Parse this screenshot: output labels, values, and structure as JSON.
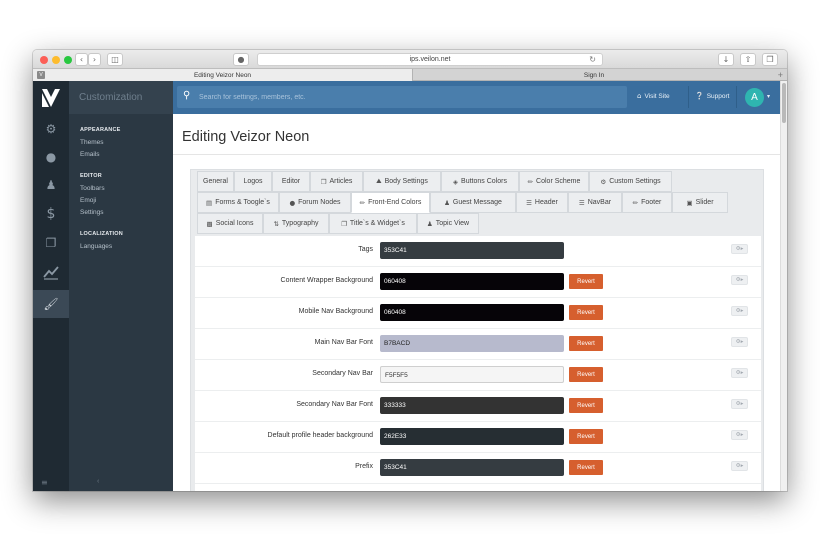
{
  "browser": {
    "url": "ips.veilon.net",
    "tabs": [
      {
        "title": "Editing Veizor Neon",
        "favicon": "V"
      },
      {
        "title": "Sign In"
      }
    ]
  },
  "rail": {
    "icons": [
      "logo-icon",
      "gears-icon",
      "chat-icon",
      "user-icon",
      "dollar-icon",
      "copy-icon",
      "chart-icon",
      "brush-icon"
    ],
    "active": "brush-icon",
    "bottom_icon": "menu-icon"
  },
  "subnav": {
    "title": "Customization",
    "groups": [
      {
        "label": "APPEARANCE",
        "items": [
          "Themes",
          "Emails"
        ]
      },
      {
        "label": "EDITOR",
        "items": [
          "Toolbars",
          "Emoji",
          "Settings"
        ]
      },
      {
        "label": "LOCALIZATION",
        "items": [
          "Languages"
        ]
      }
    ],
    "collapse_icon": "chevron-left-icon"
  },
  "topbar": {
    "search_placeholder": "Search for settings, members, etc.",
    "visit_site": "Visit Site",
    "support": "Support",
    "avatar_letter": "A"
  },
  "page": {
    "title": "Editing Veizor Neon"
  },
  "tabs": [
    {
      "label": "General",
      "icon": ""
    },
    {
      "label": "Logos",
      "icon": ""
    },
    {
      "label": "Editor",
      "icon": ""
    },
    {
      "label": "Articles",
      "icon": "articles-icon"
    },
    {
      "label": "Body Settings",
      "icon": "car-icon"
    },
    {
      "label": "Buttons Colors",
      "icon": "cube-icon"
    },
    {
      "label": "Color Scheme",
      "icon": "brush-icon"
    },
    {
      "label": "Custom Settings",
      "icon": "gear-icon"
    },
    {
      "label": "Forms & Toogle`s",
      "icon": "form-icon"
    },
    {
      "label": "Forum Nodes",
      "icon": "comments-icon"
    },
    {
      "label": "Front-End Colors",
      "icon": "brush-icon",
      "active": true
    },
    {
      "label": "Guest Message",
      "icon": "users-icon"
    },
    {
      "label": "Header",
      "icon": "bars-icon"
    },
    {
      "label": "NavBar",
      "icon": "bars-icon"
    },
    {
      "label": "Footer",
      "icon": "brush-icon"
    },
    {
      "label": "Slider",
      "icon": "monitor-icon"
    },
    {
      "label": "Social Icons",
      "icon": "share-icon"
    },
    {
      "label": "Typography",
      "icon": "sort-icon"
    },
    {
      "label": "Title`s & Widget`s",
      "icon": "window-icon"
    },
    {
      "label": "Topic View",
      "icon": "person-icon"
    }
  ],
  "settings": [
    {
      "label": "Tags",
      "value": "353C41",
      "color": "#353C41",
      "revert": false
    },
    {
      "label": "Content Wrapper Background",
      "value": "060408",
      "color": "#060408",
      "revert": true
    },
    {
      "label": "Mobile Nav Background",
      "value": "060408",
      "color": "#060408",
      "revert": true
    },
    {
      "label": "Main Nav Bar Font",
      "value": "B7BACD",
      "color": "#B7BACD",
      "revert": true
    },
    {
      "label": "Secondary Nav Bar",
      "value": "F5F5F5",
      "color": "#F5F5F5",
      "revert": true
    },
    {
      "label": "Secondary Nav Bar Font",
      "value": "333333",
      "color": "#333333",
      "revert": true
    },
    {
      "label": "Default profile header background",
      "value": "262E33",
      "color": "#262E33",
      "revert": true
    },
    {
      "label": "Prefix",
      "value": "353C41",
      "color": "#353C41",
      "revert": true
    }
  ],
  "revert_label": "Revert",
  "row_control_icon": "gear-dropdown-icon",
  "colors": {
    "accent": "#3A6E9E",
    "revert": "#D65F2E",
    "rail": "#1F2A33",
    "subnav": "#2B3843"
  }
}
